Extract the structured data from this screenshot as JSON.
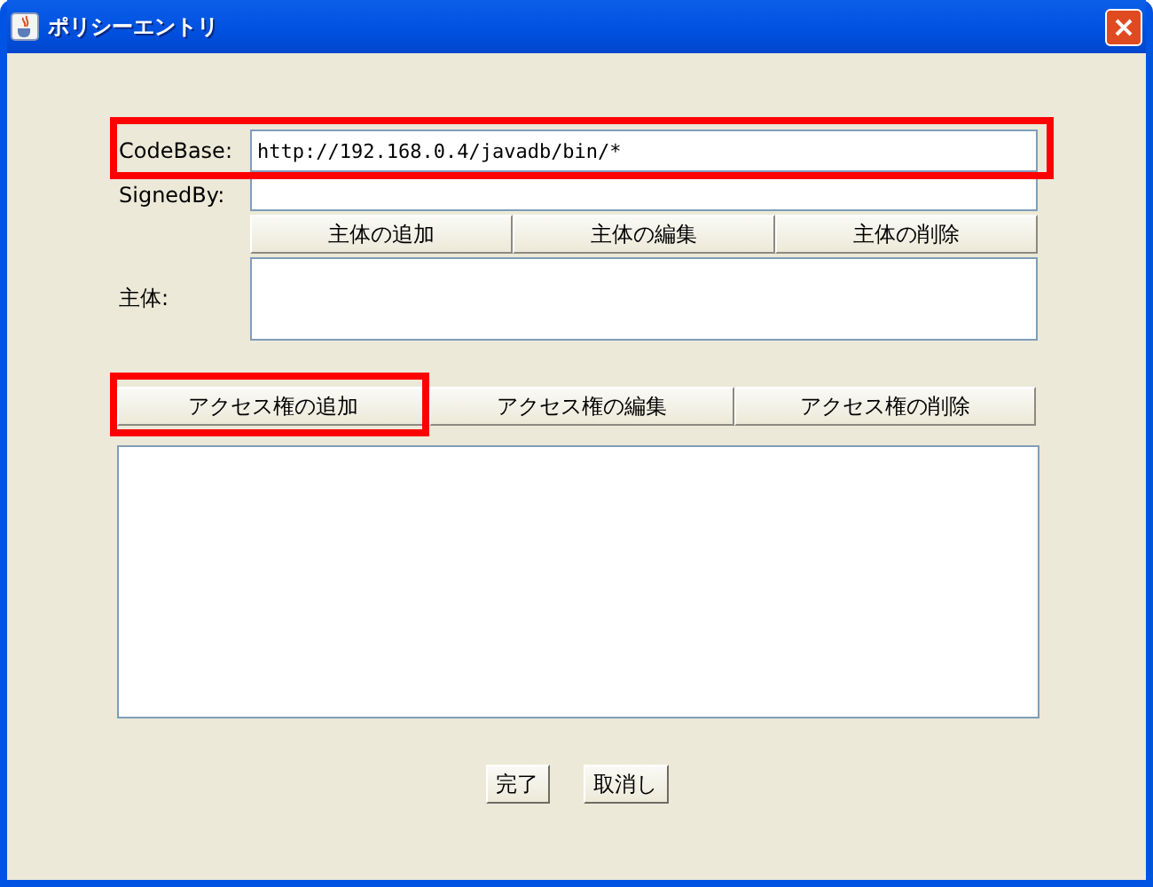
{
  "window": {
    "title": "ポリシーエントリ"
  },
  "codebase": {
    "label": "CodeBase:",
    "value": "http://192.168.0.4/javadb/bin/*",
    "highlighted": true
  },
  "signed_by": {
    "label": "SignedBy:"
  },
  "principal_buttons": [
    {
      "label": "主体の追加",
      "highlighted": false
    },
    {
      "label": "主体の編集",
      "highlighted": false
    },
    {
      "label": "主体の削除",
      "highlighted": false
    }
  ],
  "principals": {
    "label": "主体:"
  },
  "permission_buttons": [
    {
      "label": "アクセス権の追加",
      "highlighted": true
    },
    {
      "label": "アクセス権の編集",
      "highlighted": false
    },
    {
      "label": "アクセス権の削除",
      "highlighted": false
    }
  ],
  "footer_buttons": [
    "完了",
    "取消し"
  ]
}
